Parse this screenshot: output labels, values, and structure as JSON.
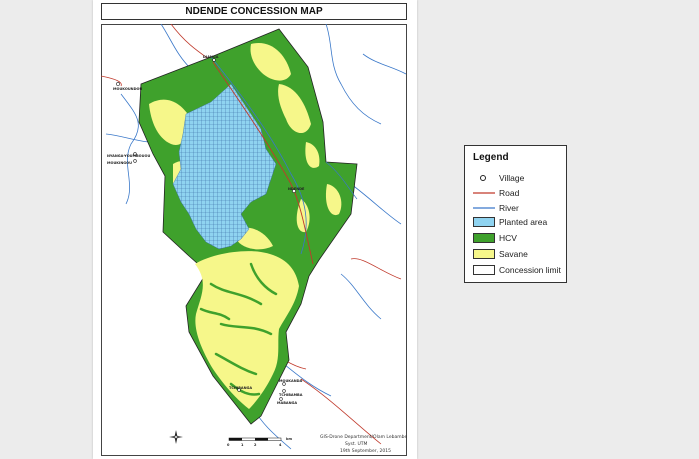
{
  "map": {
    "title": "NDENDE CONCESSION MAP",
    "villages": [
      {
        "name": "MOUKOUNDOU"
      },
      {
        "name": "NYANGA-YOUMBOUOU"
      },
      {
        "name": "MOUKINGOU"
      },
      {
        "name": "DIANGA"
      },
      {
        "name": "NDENDE"
      },
      {
        "name": "TCHIBANGA"
      },
      {
        "name": "MOUKANDA"
      },
      {
        "name": "TCHIBAMBA"
      },
      {
        "name": "MABANGA"
      }
    ],
    "scale_bar": {
      "ticks": [
        "0",
        "1",
        "2",
        "4"
      ],
      "unit": "km"
    },
    "credits": {
      "line1": "GIS-Drone Department/Olam Lebambe",
      "line2": "Syst. UTM",
      "line3": "19th September, 2015"
    }
  },
  "legend": {
    "title": "Legend",
    "items": [
      {
        "label": "Village",
        "symbol": "village"
      },
      {
        "label": "Road",
        "symbol": "line",
        "color": "#c0392b"
      },
      {
        "label": "River",
        "symbol": "line",
        "color": "#3a78c9"
      },
      {
        "label": "Planted area",
        "symbol": "box",
        "color": "#8fd3f0"
      },
      {
        "label": "HCV",
        "symbol": "box",
        "color": "#3fa12c"
      },
      {
        "label": "Savane",
        "symbol": "box",
        "color": "#f6f78a"
      },
      {
        "label": "Concession limit",
        "symbol": "box",
        "color": "#ffffff"
      }
    ]
  },
  "colors": {
    "hcv": "#3fa12c",
    "savane": "#f6f78a",
    "planted": "#8fd3f0",
    "road": "#c0392b",
    "river": "#3a78c9"
  }
}
